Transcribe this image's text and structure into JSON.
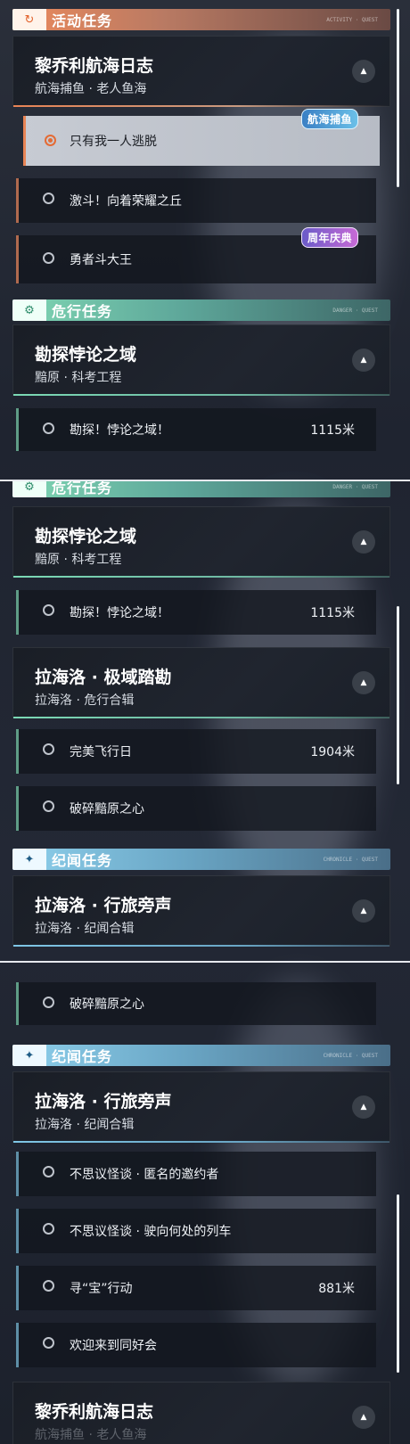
{
  "sections": {
    "activity": {
      "title": "活动任务",
      "tag": "ACTIVITY · QUEST"
    },
    "danger": {
      "title": "危行任务",
      "tag": "DANGER · QUEST"
    },
    "chronicle": {
      "title": "纪闻任务",
      "tag": "CHRONICLE · QUEST"
    }
  },
  "cards": {
    "voyage_log": {
      "title": "黎乔利航海日志",
      "subtitle": "航海捕鱼 · 老人鱼海"
    },
    "paradox_domain": {
      "title": "勘探悖论之域",
      "subtitle": "黯原 · 科考工程"
    },
    "lahailuo_polar": {
      "title": "拉海洛 · 极域踏勘",
      "subtitle": "拉海洛 · 危行合辑"
    },
    "lahailuo_travel": {
      "title": "拉海洛 · 行旅旁声",
      "subtitle": "拉海洛 · 纪闻合辑"
    }
  },
  "items": {
    "escape_alone": {
      "label": "只有我一人逃脱"
    },
    "glory_hill": {
      "label": "激斗！向着荣耀之丘"
    },
    "brave_king": {
      "label": "勇者斗大王"
    },
    "explore_paradox": {
      "label": "勘探！悖论之域！",
      "distance": "1115米"
    },
    "perfect_flight": {
      "label": "完美飞行日",
      "distance": "1904米"
    },
    "broken_plain": {
      "label": "破碎黯原之心"
    },
    "anonymous_invite": {
      "label": "不思议怪谈 · 匿名的邀约者"
    },
    "train_where": {
      "label": "不思议怪谈 · 驶向何处的列车"
    },
    "seek_treasure": {
      "label": "寻“宝”行动",
      "distance": "881米"
    },
    "welcome_club": {
      "label": "欢迎来到同好会"
    }
  },
  "event_tags": {
    "fishing": "航海捕鱼",
    "anniversary": "周年庆典",
    "anniversary_num": "1"
  },
  "partial": {
    "voyage_log_sub_cut": "航海捕鱼 · 老人鱼海"
  },
  "icons": {
    "activity": "flag-icon",
    "danger": "gear-icon",
    "chronicle": "sparkle-icon",
    "collapse": "chevron-up-icon"
  }
}
